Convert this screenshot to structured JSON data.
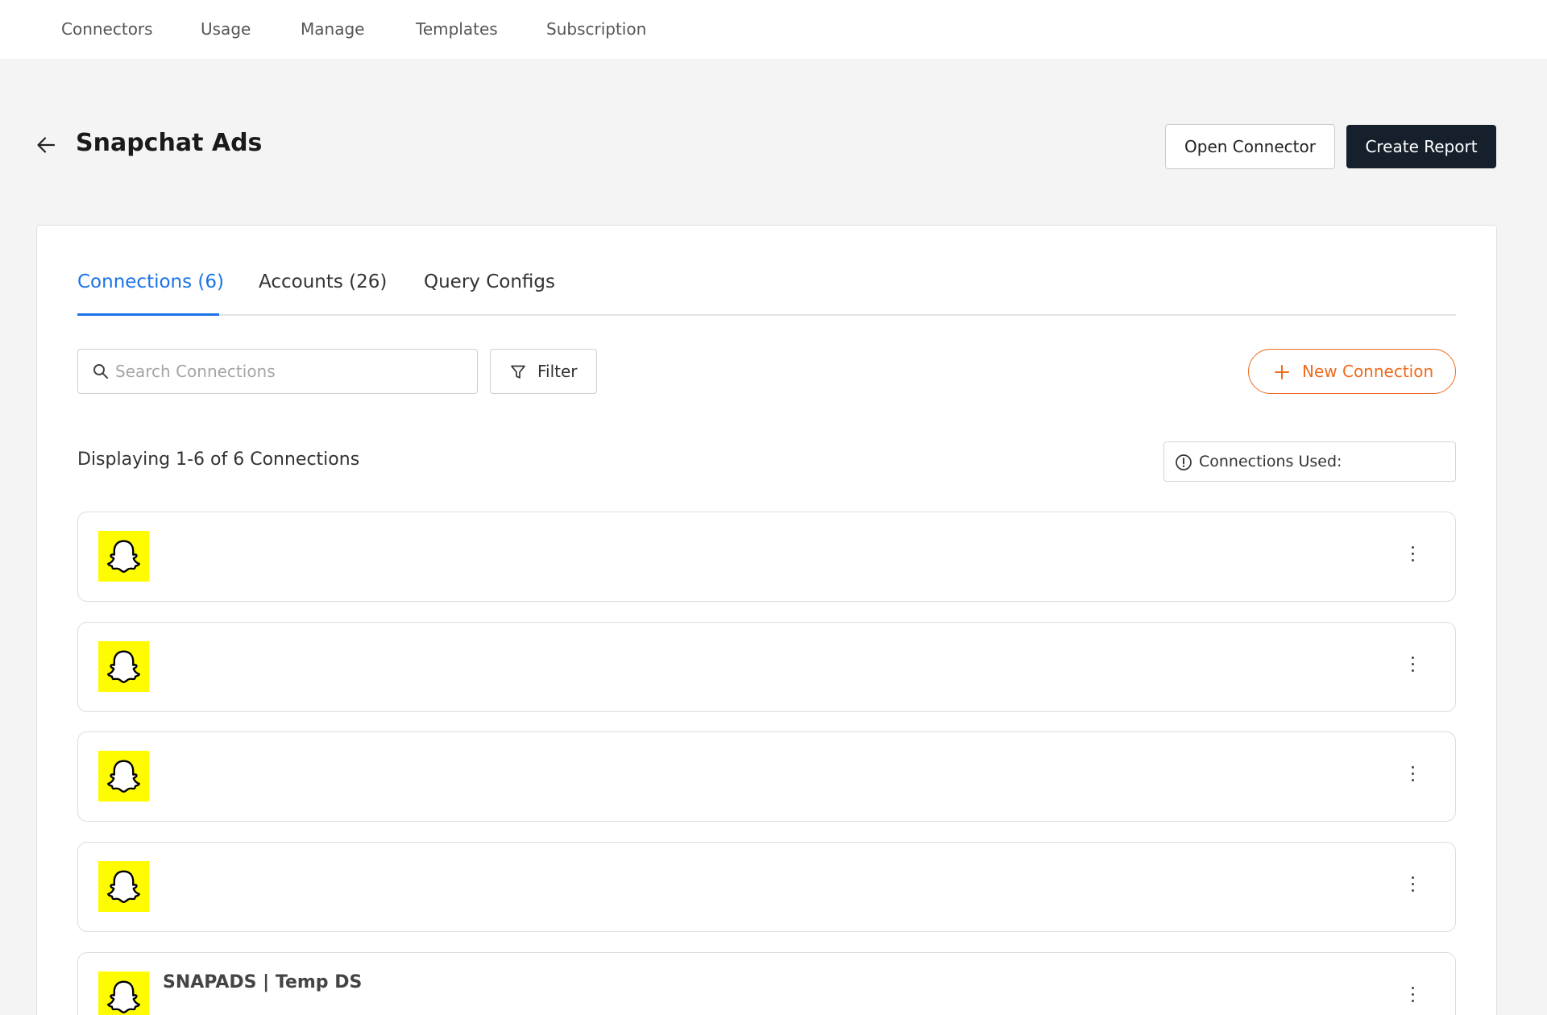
{
  "topnav": {
    "items": [
      "Connectors",
      "Usage",
      "Manage",
      "Templates",
      "Subscription"
    ]
  },
  "header": {
    "title": "Snapchat Ads",
    "open_connector_label": "Open Connector",
    "create_report_label": "Create Report"
  },
  "tabs": [
    {
      "label": "Connections (6)",
      "active": true
    },
    {
      "label": "Accounts (26)",
      "active": false
    },
    {
      "label": "Query Configs",
      "active": false
    }
  ],
  "search": {
    "placeholder": "Search Connections",
    "value": ""
  },
  "filter_label": "Filter",
  "new_connection_label": "New Connection",
  "displaying_text": "Displaying 1-6 of 6 Connections",
  "connections_used_label": "Connections Used:",
  "connections": [
    {
      "name": ""
    },
    {
      "name": ""
    },
    {
      "name": ""
    },
    {
      "name": ""
    },
    {
      "name": "SNAPADS | Temp DS"
    }
  ],
  "colors": {
    "accent_blue": "#1a73e8",
    "accent_orange": "#ef6a1c",
    "dark_button": "#16202c",
    "snapchat_yellow": "#fffc00"
  },
  "icons": {
    "back": "arrow-left-icon",
    "search": "search-icon",
    "filter": "funnel-icon",
    "new": "plus-icon",
    "info": "info-circle-icon",
    "logo": "snapchat-ghost-icon",
    "menu": "kebab-menu-icon"
  }
}
